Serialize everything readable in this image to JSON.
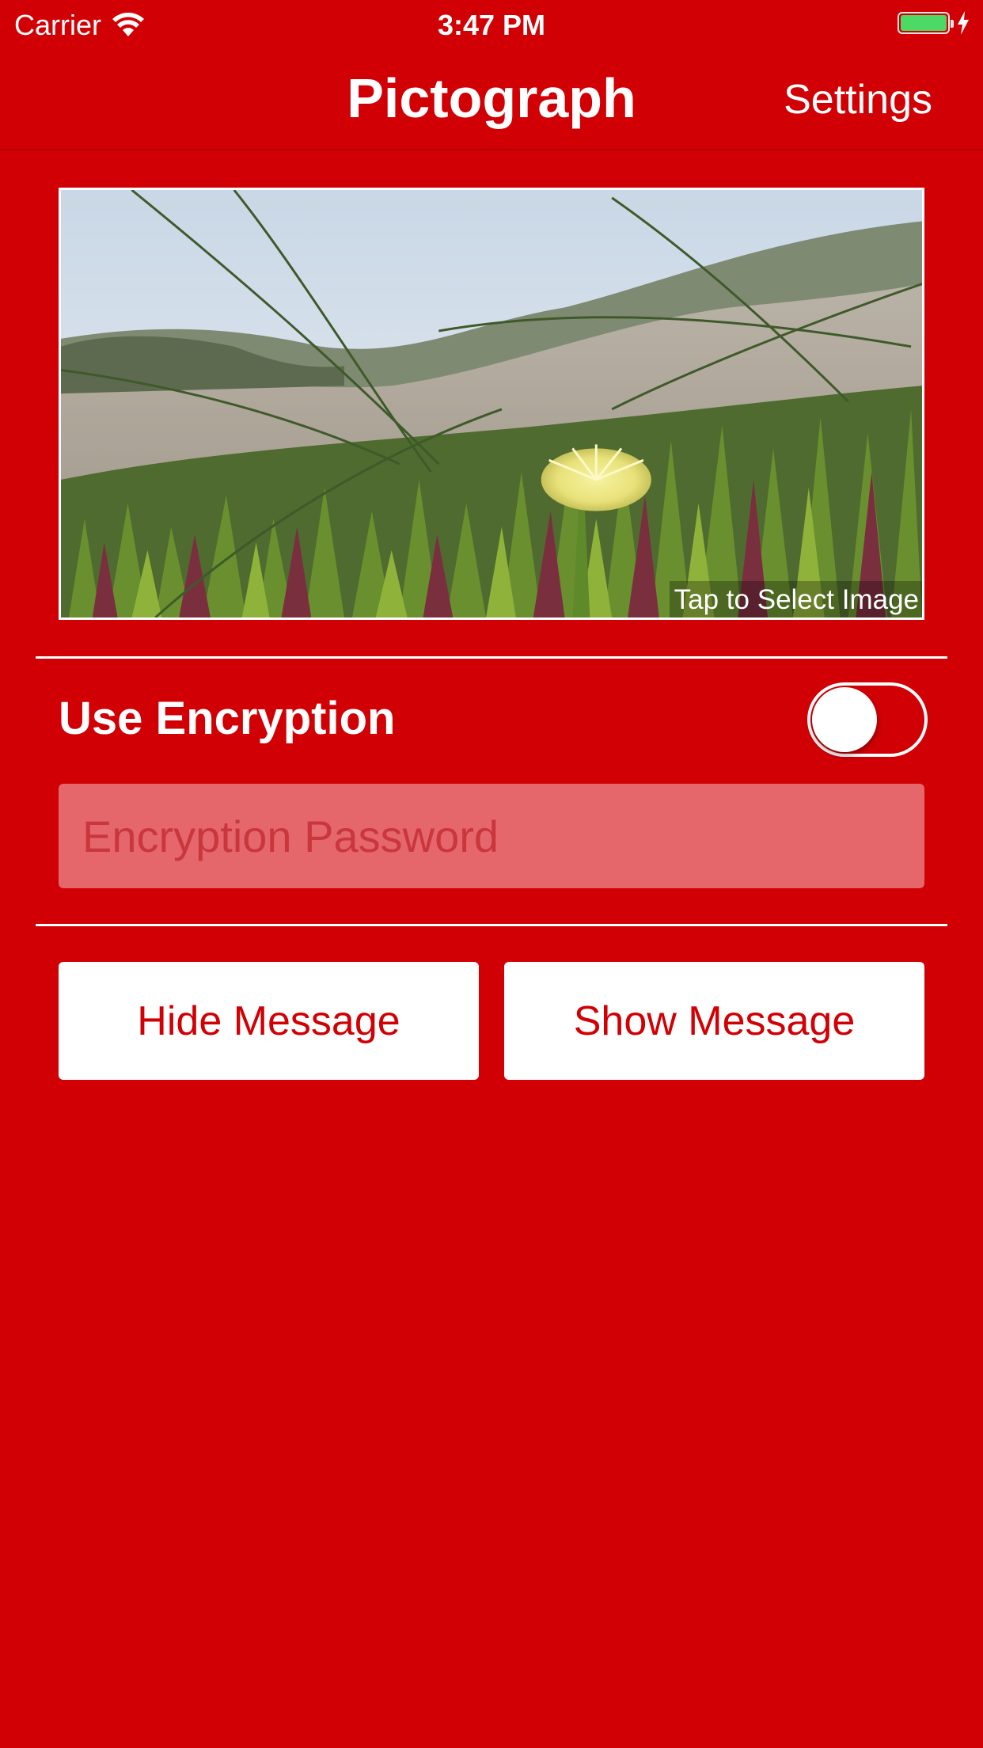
{
  "status_bar": {
    "carrier": "Carrier",
    "time": "3:47 PM",
    "battery_level": 1.0,
    "battery_color": "#4cd964",
    "charging": true
  },
  "nav": {
    "title": "Pictograph",
    "settings_label": "Settings"
  },
  "image_picker": {
    "caption": "Tap to Select Image",
    "content": "photo-dune-flower"
  },
  "encryption": {
    "label": "Use Encryption",
    "enabled": false,
    "password_placeholder": "Encryption Password",
    "password_value": ""
  },
  "actions": {
    "hide_label": "Hide Message",
    "show_label": "Show Message"
  },
  "colors": {
    "background": "#d10005",
    "field": "#e5676c",
    "button_text": "#d10005"
  }
}
